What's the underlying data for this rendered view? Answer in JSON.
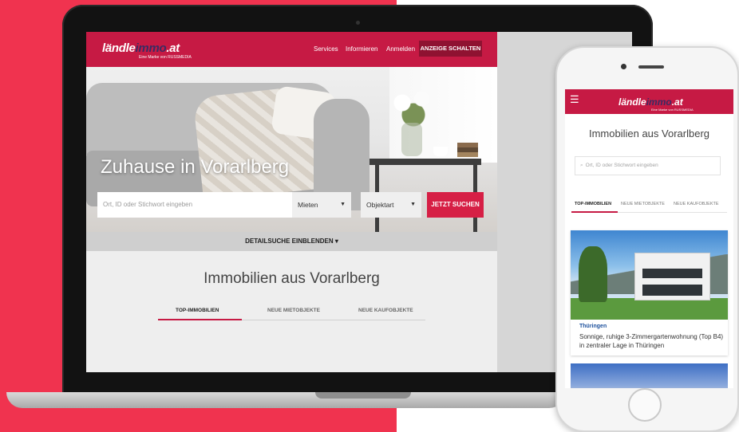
{
  "laptop": {
    "logo_left": "ländle",
    "logo_mid": "immo",
    "logo_right": ".at",
    "logo_tagline": "Eine Marke von RUSSMEDIA",
    "nav": {
      "services": "Services",
      "informieren": "Informieren",
      "anmelden": "Anmelden",
      "cta": "ANZEIGE SCHALTEN"
    },
    "hero_title": "Zuhause in Vorarlberg",
    "search": {
      "placeholder": "Ort, ID oder Stichwort eingeben",
      "mode": "Mieten",
      "type": "Objektart",
      "button": "JETZT SUCHEN"
    },
    "detail_toggle": "DETAILSUCHE EINBLENDEN",
    "detail_caret": "▾",
    "section_title": "Immobilien aus Vorarlberg",
    "tabs": [
      "TOP-IMMOBILIEN",
      "NEUE MIETOBJEKTE",
      "NEUE KAUFOBJEKTE"
    ]
  },
  "phone": {
    "menu_icon": "☰",
    "logo_left": "ländle",
    "logo_mid": "immo",
    "logo_right": ".at",
    "logo_tagline": "Eine Marke von RUSSMEDIA",
    "title": "Immobilien aus Vorarlberg",
    "search_placeholder": "Ort, ID oder Stichwort eingeben",
    "tabs": [
      "TOP-IMMOBILIEN",
      "NEUE MIETOBJEKTE",
      "NEUE KAUFOBJEKTE"
    ],
    "card": {
      "location": "Thüringen",
      "description": "Sonnige, ruhige 3-Zimmergartenwohnung (Top B4) in zentraler Lage in Thüringen"
    }
  },
  "colors": {
    "brand_red": "#c61a44",
    "background_red": "#f0334f",
    "link_blue": "#1b4f9c"
  }
}
